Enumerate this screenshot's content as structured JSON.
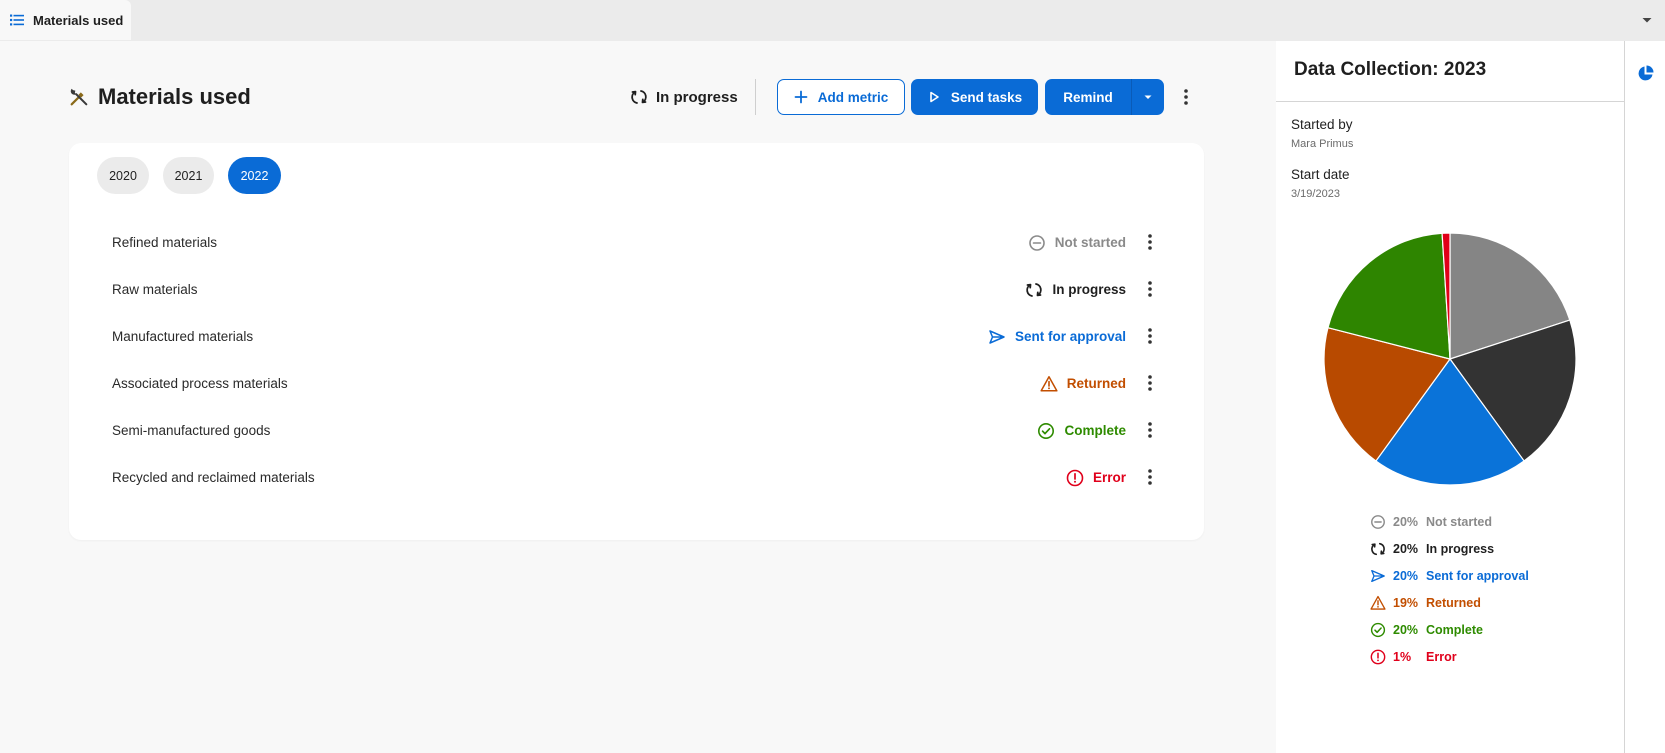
{
  "tab": {
    "label": "Materials used"
  },
  "header": {
    "title": "Materials used",
    "status": "In progress",
    "add_metric": "Add metric",
    "send_tasks": "Send tasks",
    "remind": "Remind"
  },
  "years": [
    "2020",
    "2021",
    "2022"
  ],
  "selected_year": "2022",
  "rows": [
    {
      "label": "Refined materials",
      "status": "Not started",
      "status_key": "not-started"
    },
    {
      "label": "Raw materials",
      "status": "In progress",
      "status_key": "in-progress"
    },
    {
      "label": "Manufactured materials",
      "status": "Sent for approval",
      "status_key": "sent"
    },
    {
      "label": "Associated process materials",
      "status": "Returned",
      "status_key": "returned"
    },
    {
      "label": "Semi-manufactured goods",
      "status": "Complete",
      "status_key": "complete"
    },
    {
      "label": "Recycled and reclaimed materials",
      "status": "Error",
      "status_key": "error"
    }
  ],
  "panel": {
    "title": "Data Collection: 2023",
    "started_by_label": "Started by",
    "started_by": "Mara Primus",
    "start_date_label": "Start date",
    "start_date": "3/19/2023"
  },
  "status_colors": {
    "not-started": "#8a8a8a",
    "in-progress": "#1f1f1f",
    "sent": "#0a6bd6",
    "returned": "#c24e00",
    "complete": "#2e8b00",
    "error": "#e0001b"
  },
  "chart_data": {
    "type": "pie",
    "slices": [
      {
        "label": "Not started",
        "pct": "20%",
        "value": 20,
        "color": "#858585",
        "key": "not-started"
      },
      {
        "label": "In progress",
        "pct": "20%",
        "value": 20,
        "color": "#333333",
        "key": "in-progress"
      },
      {
        "label": "Sent for approval",
        "pct": "20%",
        "value": 20,
        "color": "#0a73d9",
        "key": "sent"
      },
      {
        "label": "Returned",
        "pct": "19%",
        "value": 19,
        "color": "#b84a00",
        "key": "returned"
      },
      {
        "label": "Complete",
        "pct": "20%",
        "value": 20,
        "color": "#2e8500",
        "key": "complete"
      },
      {
        "label": "Error",
        "pct": "1%",
        "value": 1,
        "color": "#e00018",
        "key": "error"
      }
    ]
  }
}
